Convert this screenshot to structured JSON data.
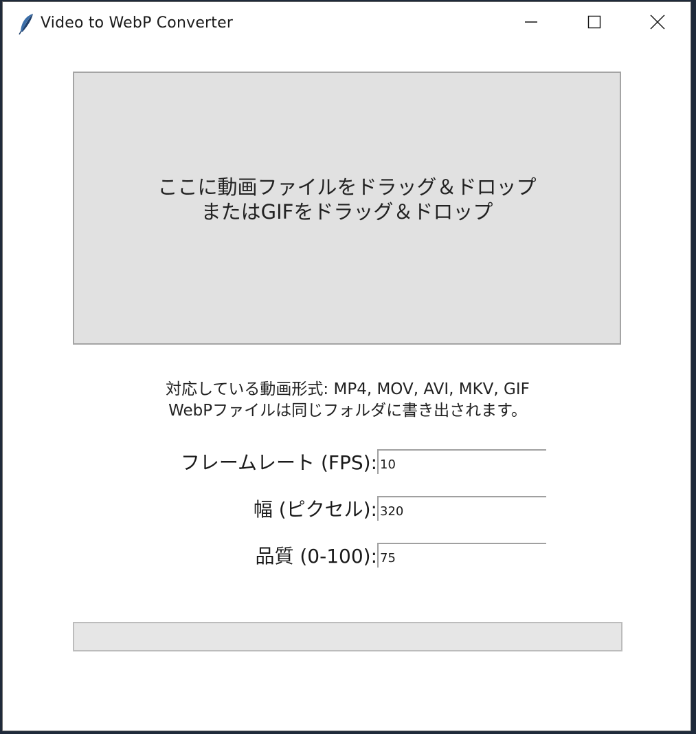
{
  "window": {
    "title": "Video to WebP Converter",
    "icon": "feather-icon"
  },
  "titlebar_controls": {
    "minimize_icon": "minimize-icon",
    "maximize_icon": "maximize-icon",
    "close_icon": "close-icon"
  },
  "drop_zone": {
    "line1": "ここに動画ファイルをドラッグ＆ドロップ",
    "line2": "またはGIFをドラッグ＆ドロップ"
  },
  "info": {
    "line1": "対応している動画形式: MP4, MOV, AVI, MKV, GIF",
    "line2": "WebPファイルは同じフォルダに書き出されます。"
  },
  "settings": {
    "fps": {
      "label": "フレームレート (FPS):",
      "value": "10"
    },
    "width": {
      "label": "幅 (ピクセル):",
      "value": "320"
    },
    "quality": {
      "label": "品質 (0-100):",
      "value": "75"
    }
  },
  "progress": {
    "value": 0
  },
  "colors": {
    "drop_zone_bg": "#e1e1e1",
    "progress_bg": "#e6e6e6",
    "window_bg": "#ffffff"
  }
}
